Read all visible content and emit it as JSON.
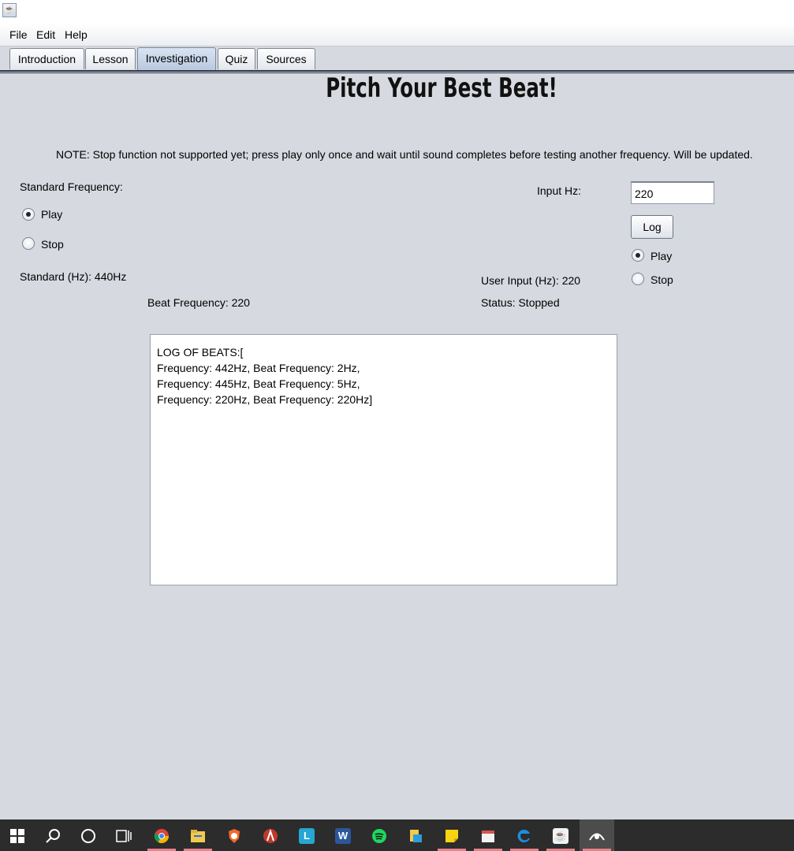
{
  "menu": [
    "File",
    "Edit",
    "Help"
  ],
  "tabs": [
    "Introduction",
    "Lesson",
    "Investigation",
    "Quiz",
    "Sources"
  ],
  "active_tab": "Investigation",
  "title": "Pitch Your Best Beat!",
  "note": "NOTE: Stop function not supported yet; press play only once and wait until sound completes before testing another frequency. Will be updated.",
  "standard": {
    "heading": "Standard Frequency:",
    "play_label": "Play",
    "stop_label": "Stop",
    "selected": "Play",
    "standard_text": "Standard (Hz): 440Hz",
    "beat_text": "Beat Frequency: 220"
  },
  "user": {
    "input_label": "Input Hz:",
    "input_value": "220",
    "log_button": "Log",
    "play_label": "Play",
    "stop_label": "Stop",
    "selected": "Play",
    "user_input_text": "User Input (Hz): 220",
    "status_text": "Status: Stopped"
  },
  "log_lines": [
    "LOG OF BEATS:[",
    "Frequency: 442Hz, Beat Frequency: 2Hz,",
    "Frequency: 445Hz, Beat Frequency: 5Hz,",
    "Frequency: 220Hz, Beat Frequency: 220Hz]"
  ],
  "taskbar": [
    "windows-start-icon",
    "search-icon",
    "cortana-icon",
    "task-view-icon",
    "chrome-icon",
    "file-explorer-icon",
    "brave-icon",
    "racket-icon",
    "l-app-icon",
    "word-icon",
    "spotify-icon",
    "files-icon",
    "sticky-notes-icon",
    "calendar-icon",
    "edge-icon",
    "java-icon",
    "pinned-app-icon"
  ]
}
